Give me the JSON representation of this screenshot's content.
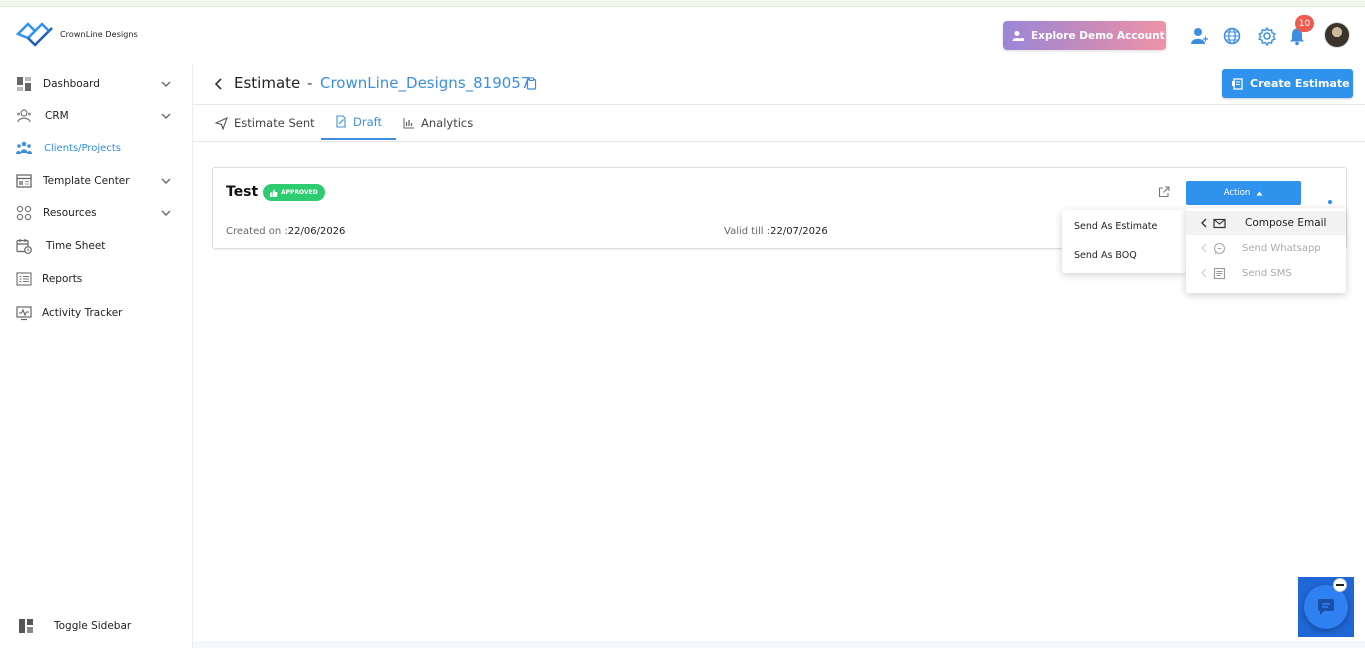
{
  "app": {
    "logo_text": "CrownLine Designs"
  },
  "header": {
    "demo_button": "Explore Demo Account",
    "notification_count": "10"
  },
  "sidebar": {
    "items": [
      {
        "label": "Dashboard",
        "icon": "dashboard-icon",
        "has_chevron": true
      },
      {
        "label": "CRM",
        "icon": "crm-icon",
        "has_chevron": true
      },
      {
        "label": "Clients/Projects",
        "icon": "clients-icon",
        "active": true
      },
      {
        "label": "Template Center",
        "icon": "template-icon",
        "has_chevron": true
      },
      {
        "label": "Resources",
        "icon": "resources-icon",
        "has_chevron": true
      },
      {
        "label": "Time Sheet",
        "icon": "timesheet-icon"
      },
      {
        "label": "Reports",
        "icon": "reports-icon"
      },
      {
        "label": "Activity Tracker",
        "icon": "activity-icon"
      }
    ],
    "toggle_label": "Toggle Sidebar"
  },
  "page": {
    "title": "Estimate",
    "dash": "-",
    "project_id": "CrownLine_Designs_819057",
    "create_button": "Create Estimate"
  },
  "tabs": [
    {
      "label": "Estimate Sent"
    },
    {
      "label": "Draft",
      "active": true
    },
    {
      "label": "Analytics"
    }
  ],
  "estimate": {
    "name": "Test",
    "status": "APPROVED",
    "created_label": "Created on :",
    "created_value": "22/06/2026",
    "valid_label": "Valid till :",
    "valid_value": "22/07/2026",
    "action_label": "Action"
  },
  "submenu": [
    "Send As Estimate",
    "Send As BOQ"
  ],
  "dropdown": [
    {
      "label": "Compose Email",
      "icon": "mail-icon",
      "highlighted": true
    },
    {
      "label": "Send Whatsapp",
      "icon": "chat-icon",
      "disabled": true
    },
    {
      "label": "Send SMS",
      "icon": "sms-icon",
      "disabled": true
    }
  ],
  "colors": {
    "accent": "#2f93ee",
    "approved": "#2ecc71",
    "badge": "#f05b4f"
  }
}
